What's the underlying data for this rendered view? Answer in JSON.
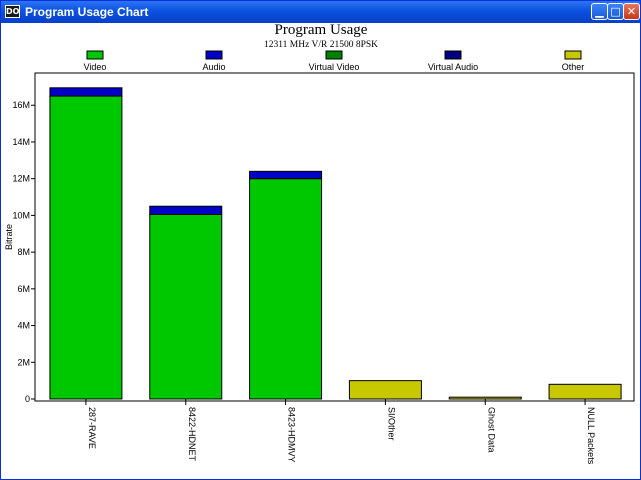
{
  "window": {
    "title": "Program Usage Chart",
    "icon_text": "DO",
    "buttons": {
      "minimize": "minimize-icon",
      "maximize": "maximize-icon",
      "close": "close-icon"
    }
  },
  "chart_data": {
    "type": "bar",
    "stacked": true,
    "title": "Program Usage",
    "subtitle": "12311 MHz V/R 21500 8PSK",
    "ylabel": "Bitrate",
    "xlabel": "",
    "ylim": [
      0,
      18
    ],
    "yticks": [
      0,
      2,
      4,
      6,
      8,
      10,
      12,
      14,
      16
    ],
    "ytick_suffix": "M",
    "grid": false,
    "legend_position": "top",
    "categories": [
      "287-RAVE",
      "8422-HDNET",
      "8423-HDMVY",
      "SI/Other",
      "Ghost Data",
      "NULL Packets"
    ],
    "series": [
      {
        "name": "Video",
        "color": "#00c800",
        "values": [
          16.5,
          10.05,
          12.0,
          0,
          0,
          0
        ]
      },
      {
        "name": "Audio",
        "color": "#0000c8",
        "values": [
          0.45,
          0.45,
          0.4,
          0,
          0,
          0
        ]
      },
      {
        "name": "Virtual Video",
        "color": "#008000",
        "values": [
          0,
          0,
          0,
          0,
          0,
          0
        ]
      },
      {
        "name": "Virtual Audio",
        "color": "#000080",
        "values": [
          0,
          0,
          0,
          0,
          0,
          0
        ]
      },
      {
        "name": "Other",
        "color": "#c8c800",
        "values": [
          0,
          0,
          0,
          1.0,
          0.1,
          0.8
        ]
      }
    ]
  }
}
